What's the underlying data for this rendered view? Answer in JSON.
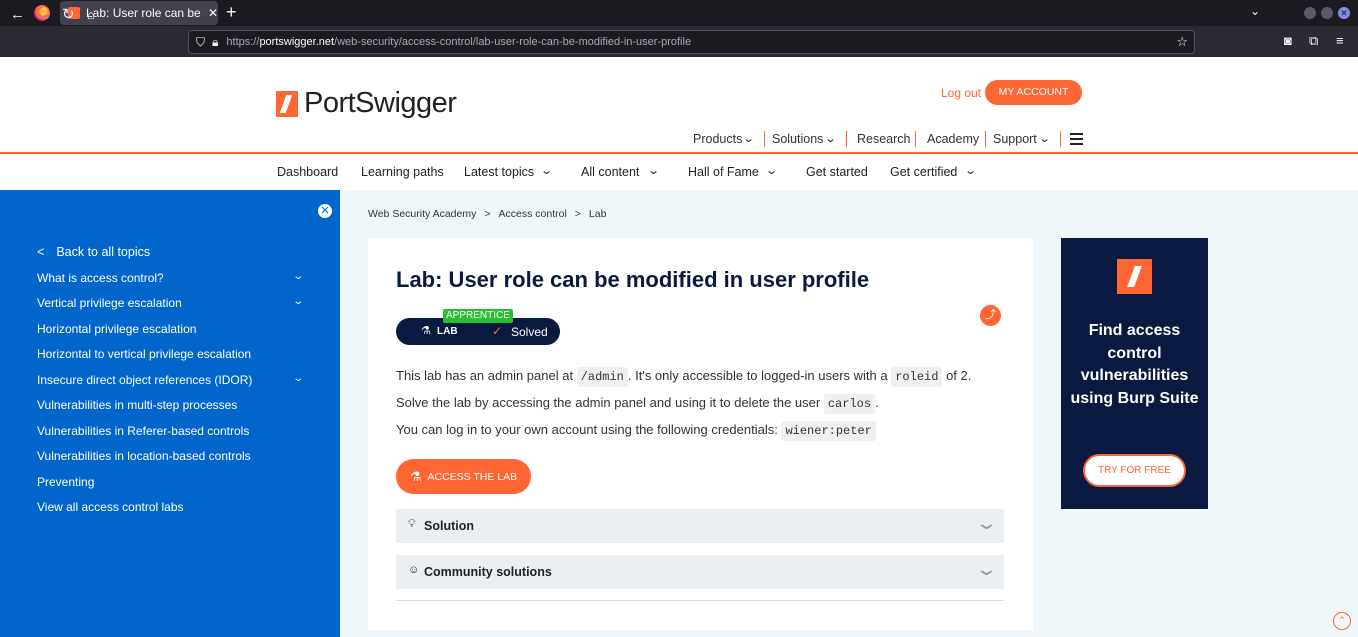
{
  "browser": {
    "tab_title": "Lab: User role can be modi",
    "tab_close": "✕",
    "new_tab": "+",
    "url_prefix": "https://",
    "url_host": "portswigger.net",
    "url_path": "/web-security/access-control/lab-user-role-can-be-modified-in-user-profile"
  },
  "header": {
    "logo_text": "PortSwigger",
    "logout": "Log out",
    "my_account": "MY ACCOUNT",
    "nav": [
      "Products",
      "Solutions",
      "Research",
      "Academy",
      "Support"
    ]
  },
  "subnav": [
    "Dashboard",
    "Learning paths",
    "Latest topics",
    "All content",
    "Hall of Fame",
    "Get started",
    "Get certified"
  ],
  "sidebar": {
    "back": "Back to all topics",
    "items": [
      "What is access control?",
      "Vertical privilege escalation",
      "Horizontal privilege escalation",
      "Horizontal to vertical privilege escalation",
      "Insecure direct object references (IDOR)",
      "Vulnerabilities in multi-step processes",
      "Vulnerabilities in Referer-based controls",
      "Vulnerabilities in location-based controls",
      "Preventing",
      "View all access control labs"
    ]
  },
  "breadcrumb": [
    "Web Security Academy",
    "Access control",
    "Lab"
  ],
  "breadcrumb_sep": ">",
  "lab": {
    "title": "Lab: User role can be modified in user profile",
    "level": "APPRENTICE",
    "badge_lab": "LAB",
    "status": "Solved",
    "p1_a": "This lab has an admin panel at ",
    "p1_code1": "/admin",
    "p1_b": ". It's only accessible to logged-in users with a ",
    "p1_code2": "roleid",
    "p1_c": " of 2.",
    "p2_a": "Solve the lab by accessing the admin panel and using it to delete the user ",
    "p2_code": "carlos",
    "p2_b": ".",
    "p3_a": "You can log in to your own account using the following credentials: ",
    "p3_code": "wiener:peter",
    "access_button": "ACCESS THE LAB",
    "solution": "Solution",
    "community": "Community solutions"
  },
  "ad": {
    "text": "Find access control vulnerabilities using Burp Suite",
    "button": "TRY FOR FREE"
  }
}
